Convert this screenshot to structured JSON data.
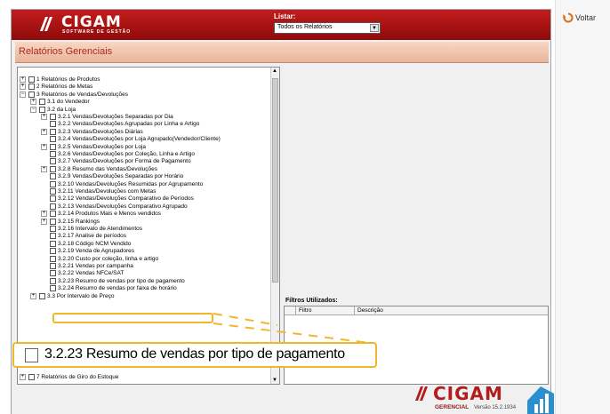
{
  "header": {
    "brand": "CIGAM",
    "brand_tagline": "SOFTWARE DE GESTÃO",
    "list_label": "Listar:",
    "list_select_value": "Todos os Relatórios"
  },
  "page": {
    "title": "Relatórios Gerenciais"
  },
  "side": {
    "back_label": "Voltar"
  },
  "tree": {
    "rows": [
      {
        "text": "1 Relatórios de Produtos",
        "exp": "+",
        "indent": 0
      },
      {
        "text": "2 Relatórios de Metas",
        "exp": "+",
        "indent": 0
      },
      {
        "text": "3 Relatórios de Vendas/Devoluções",
        "exp": "−",
        "indent": 0
      },
      {
        "text": "3.1 do Vendedor",
        "exp": "+",
        "indent": 1
      },
      {
        "text": "3.2 da Loja",
        "exp": "−",
        "indent": 1
      },
      {
        "text": "3.2.1 Vendas/Devoluções Separadas por Dia",
        "exp": "+",
        "indent": 2
      },
      {
        "text": "3.2.2 Vendas/Devoluções Agrupadas por Linha e Artigo",
        "exp": "",
        "indent": 2
      },
      {
        "text": "3.2.3 Vendas/Devoluções Diárias",
        "exp": "+",
        "indent": 2
      },
      {
        "text": "3.2.4 Vendas/Devoluções por Loja Agrupado(Vendedor/Cliente)",
        "exp": "",
        "indent": 2
      },
      {
        "text": "3.2.5 Vendas/Devoluções por Loja",
        "exp": "+",
        "indent": 2
      },
      {
        "text": "3.2.6 Vendas/Devoluções por Coleção, Linha e Artigo",
        "exp": "",
        "indent": 2
      },
      {
        "text": "3.2.7 Vendas/Devoluções por Forma de Pagamento",
        "exp": "",
        "indent": 2
      },
      {
        "text": "3.2.8 Resumo das Vendas/Devoluções",
        "exp": "+",
        "indent": 2
      },
      {
        "text": "3.2.9 Vendas/Devoluções Separadas por Horário",
        "exp": "",
        "indent": 2
      },
      {
        "text": "3.2.10 Vendas/Devoluções Resumidas por Agrupamento",
        "exp": "",
        "indent": 2
      },
      {
        "text": "3.2.11 Vendas/Devoluções com Metas",
        "exp": "",
        "indent": 2
      },
      {
        "text": "3.2.12 Vendas/Devoluções Comparativo de Períodos",
        "exp": "",
        "indent": 2
      },
      {
        "text": "3.2.13 Vendas/Devoluções Comparativo Agrupado",
        "exp": "",
        "indent": 2
      },
      {
        "text": "3.2.14 Produtos Mais e Menos vendidos",
        "exp": "+",
        "indent": 2
      },
      {
        "text": "3.2.15 Rankings",
        "exp": "+",
        "indent": 2
      },
      {
        "text": "3.2.16 Intervalo de Atendimentos",
        "exp": "",
        "indent": 2
      },
      {
        "text": "3.2.17 Analise de períodos",
        "exp": "",
        "indent": 2
      },
      {
        "text": "3.2.18 Código NCM Vendido",
        "exp": "",
        "indent": 2
      },
      {
        "text": "3.2.19 Venda de Agrupadores",
        "exp": "",
        "indent": 2
      },
      {
        "text": "3.2.20 Custo por coleção, linha e artigo",
        "exp": "",
        "indent": 2
      },
      {
        "text": "3.2.21 Vendas por campanha",
        "exp": "",
        "indent": 2
      },
      {
        "text": "3.2.22 Vendas NFCe/SAT",
        "exp": "",
        "indent": 2
      },
      {
        "text": "3.2.23 Resumo de vendas por tipo de pagamento",
        "exp": "",
        "indent": 2
      },
      {
        "text": "3.2.24 Resumo de vendas por faixa de horário",
        "exp": "",
        "indent": 2
      },
      {
        "text": "3.3 Por Intervalo de Preço",
        "exp": "+",
        "indent": 1
      }
    ],
    "last_row": {
      "text": "7 Relatórios de Giro do Estoque",
      "exp": "+"
    }
  },
  "filters": {
    "label": "Filtros Utilizados:",
    "col_filtro": "Filtro",
    "col_descricao": "Descrição"
  },
  "footer": {
    "brand": "CIGAM",
    "product": "GERENCIAL",
    "version": "Versão 15.2.1934"
  },
  "highlight": {
    "zoom_text": "3.2.23 Resumo de vendas por tipo de pagamento"
  },
  "colors": {
    "brand_red": "#b11d1d",
    "highlight": "#f1b72c",
    "title_text": "#b3261e"
  }
}
